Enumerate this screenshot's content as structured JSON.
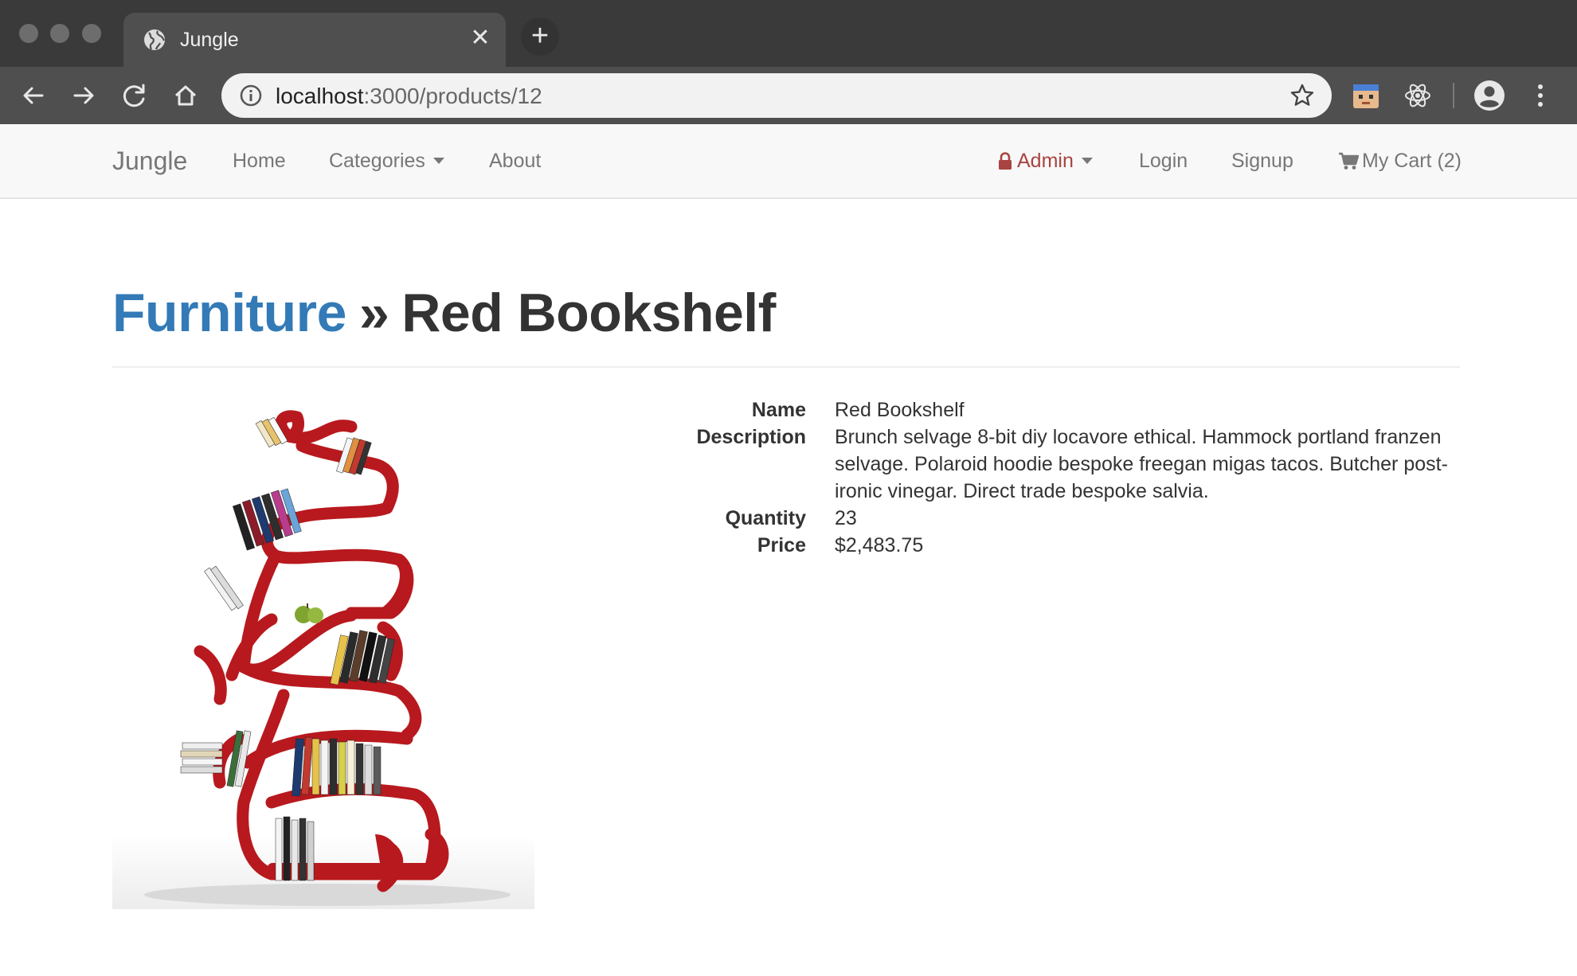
{
  "browser": {
    "tab_title": "Jungle",
    "tab_close": "✕",
    "new_tab": "+",
    "url_host": "localhost",
    "url_rest": ":3000/products/12"
  },
  "navbar": {
    "brand": "Jungle",
    "home": "Home",
    "categories": "Categories",
    "about": "About",
    "admin": "Admin",
    "login": "Login",
    "signup": "Signup",
    "cart": "My Cart (2)"
  },
  "page": {
    "category": "Furniture",
    "separator": "»",
    "title": "Red Bookshelf"
  },
  "product": {
    "labels": {
      "name": "Name",
      "description": "Description",
      "quantity": "Quantity",
      "price": "Price"
    },
    "name": "Red Bookshelf",
    "description": "Brunch selvage 8-bit diy locavore ethical. Hammock portland franzen selvage. Polaroid hoodie bespoke freegan migas tacos. Butcher post-ironic vinegar. Direct trade bespoke salvia.",
    "quantity": "23",
    "price": "$2,483.75"
  },
  "colors": {
    "link": "#337ab7",
    "admin": "#a94442",
    "shelf_red": "#b8191e"
  }
}
